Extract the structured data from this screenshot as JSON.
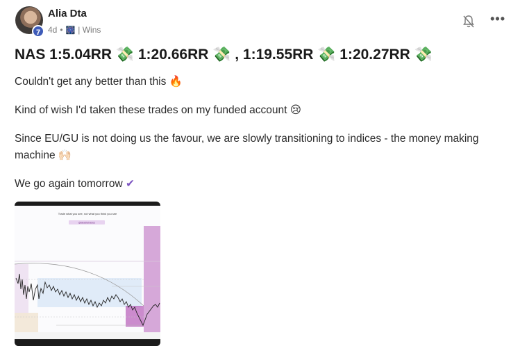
{
  "post": {
    "author": "Alia Dta",
    "level": "7",
    "time_ago": "4d",
    "separator": "•",
    "category": "| Wins",
    "title": "NAS 1:5.04RR 💸 1:20.66RR 💸 , 1:19.55RR 💸 1:20.27RR 💸",
    "paragraphs": [
      "Couldn't get any better than this 🔥",
      "Kind of wish I'd taken these trades on my funded account 😢",
      "Since EU/GU is not doing us the favour, we are slowly transitioning to indices - the money making machine 🙌🏻",
      "We go again tomorrow"
    ],
    "check_mark": "✔"
  },
  "chart_image": {
    "caption_top": "Trade what you see, not what you think you see",
    "handle": "@aliadtatrades"
  },
  "colors": {
    "accent": "#7e57c2",
    "badge": "#3e5bb8",
    "zone_pink": "#c98ccc"
  }
}
